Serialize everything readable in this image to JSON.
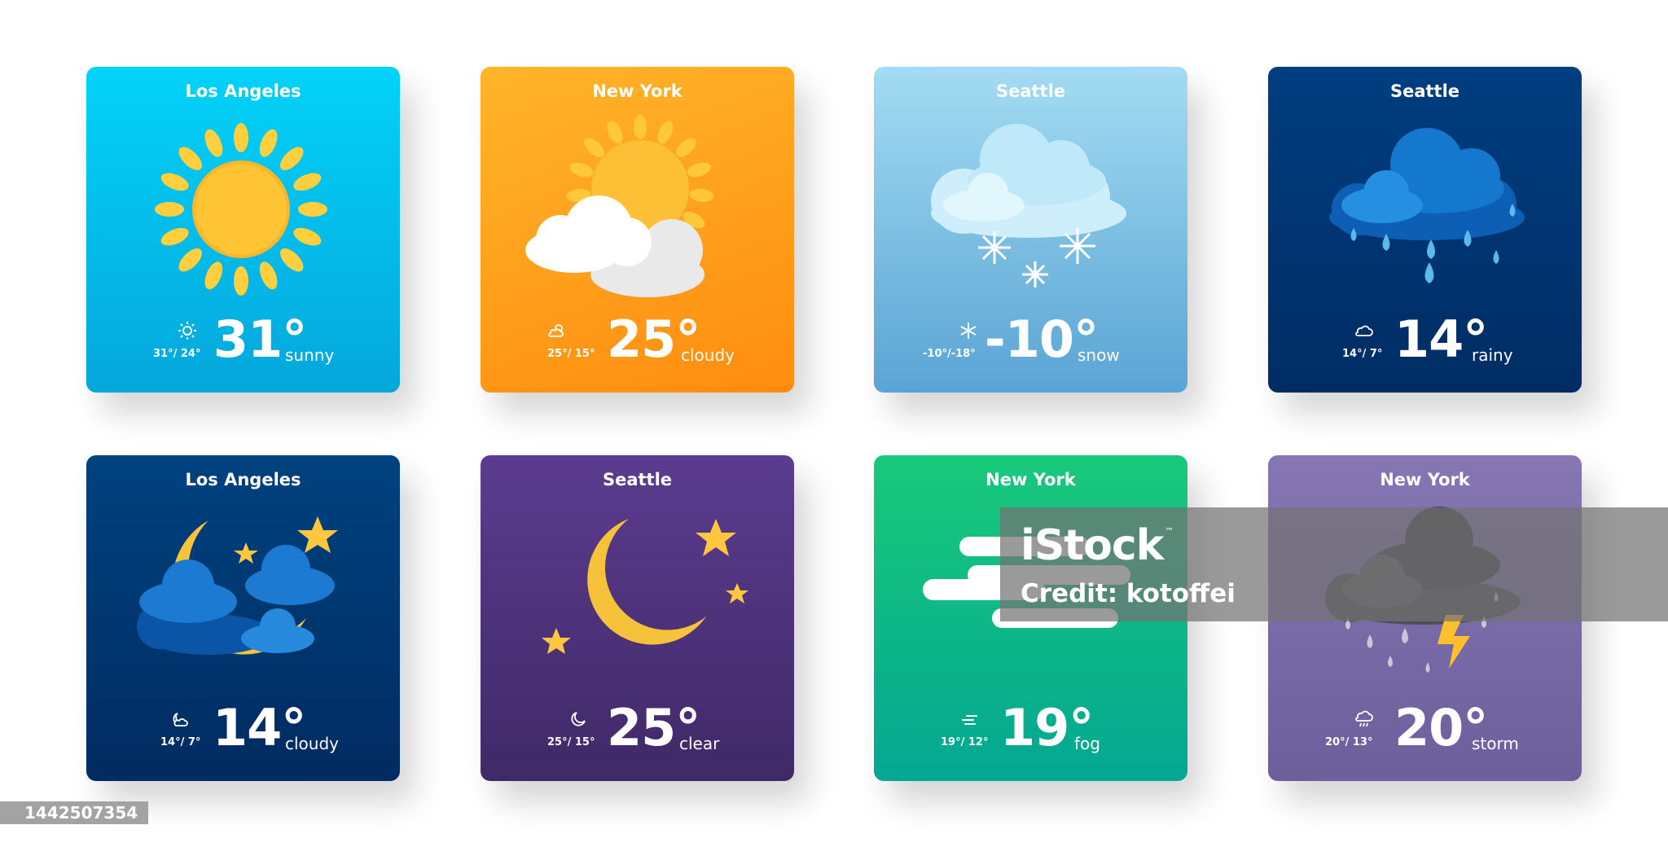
{
  "cards": [
    {
      "city": "Los Angeles",
      "minmax": "31°/ 24°",
      "temp": "31°",
      "condition": "sunny",
      "icon": "sun-icon"
    },
    {
      "city": "New York",
      "minmax": "25°/ 15°",
      "temp": "25°",
      "condition": "cloudy",
      "icon": "sun-behind-cloud-icon"
    },
    {
      "city": "Seattle",
      "minmax": "-10°/-18°",
      "temp": "-10°",
      "condition": "snow",
      "icon": "snow-cloud-icon"
    },
    {
      "city": "Seattle",
      "minmax": "14°/ 7°",
      "temp": "14°",
      "condition": "rainy",
      "icon": "rain-cloud-icon"
    },
    {
      "city": "Los Angeles",
      "minmax": "14°/ 7°",
      "temp": "14°",
      "condition": "cloudy",
      "icon": "moon-behind-cloud-icon"
    },
    {
      "city": "Seattle",
      "minmax": "25°/ 15°",
      "temp": "25°",
      "condition": "clear",
      "icon": "moon-stars-icon"
    },
    {
      "city": "New York",
      "minmax": "19°/ 12°",
      "temp": "19°",
      "condition": "fog",
      "icon": "fog-icon"
    },
    {
      "city": "New York",
      "minmax": "20°/ 13°",
      "temp": "20°",
      "condition": "storm",
      "icon": "thunderstorm-icon"
    }
  ],
  "watermark": {
    "logo": "iStock",
    "trademark": "™",
    "credit": "Credit: kotoffei"
  },
  "stock_id": "1442507354",
  "colors": {
    "sunny": "#03c3ee",
    "cloudy_day": "#ff9f1c",
    "snow": "#7fc0e4",
    "rainy": "#003570",
    "cloudy_night": "#003570",
    "clear_night": "#4d3279",
    "fog": "#0fb98a",
    "storm": "#7b6ba9"
  }
}
